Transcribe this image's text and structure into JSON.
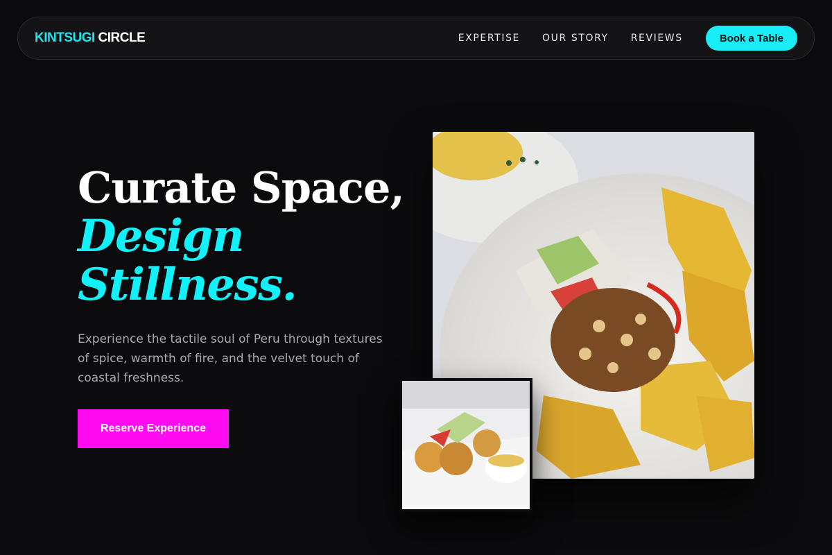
{
  "nav": {
    "logo_accent": "KINTSUGI",
    "logo_rest": " CIRCLE",
    "links": [
      "EXPERTISE",
      "OUR STORY",
      "REVIEWS"
    ],
    "cta_label": "Book a Table"
  },
  "hero": {
    "title_line1": "Curate Space,",
    "title_line2": "Design",
    "title_line3": "Stillness.",
    "description": "Experience the tactile soul of Peru through textures of spice, warmth of fire, and the velvet touch of coastal freshness.",
    "cta_label": "Reserve Experience"
  },
  "colors": {
    "background": "#0b0b0d",
    "accent_cyan": "#19eef7",
    "accent_magenta": "#ff0cf3"
  },
  "images": {
    "main": "food-plate-photo",
    "secondary": "appetizer-photo"
  }
}
